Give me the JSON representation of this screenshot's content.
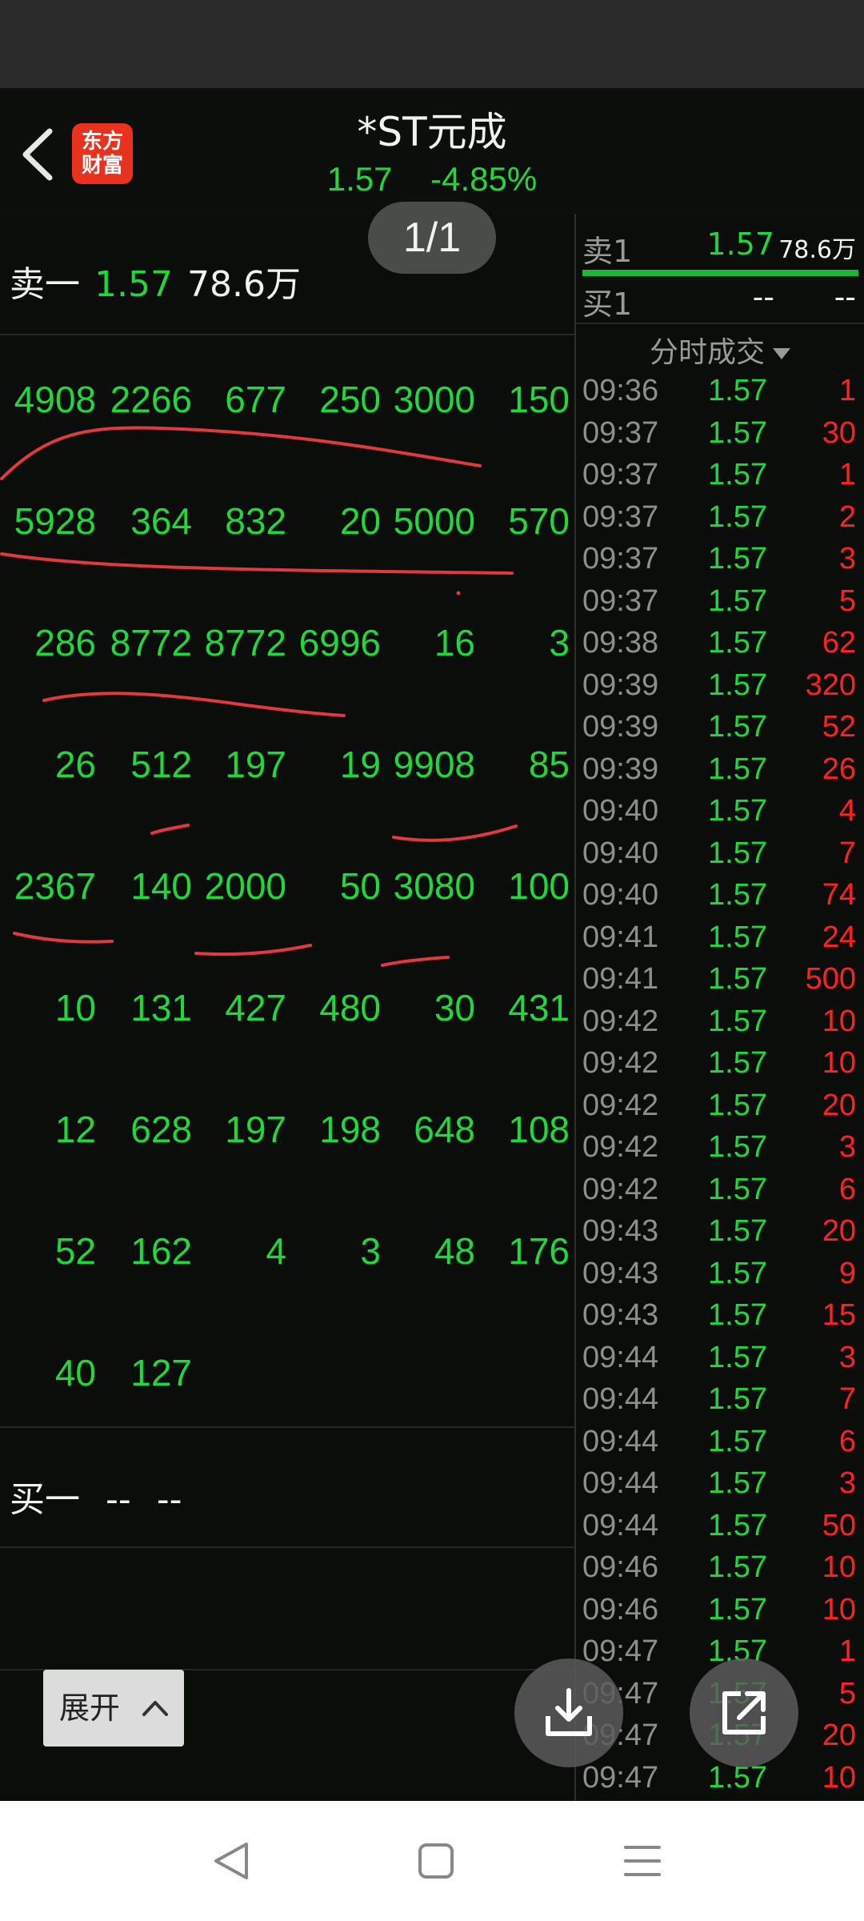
{
  "header": {
    "back_icon": "chevron-left-icon",
    "logo_text_line1": "东方",
    "logo_text_line2": "财富",
    "title": "*ST元成",
    "price": "1.57",
    "change_pct": "-4.85%"
  },
  "pager": {
    "label": "1/1"
  },
  "sell_one": {
    "label": "卖一",
    "price": "1.57",
    "volume": "78.6万"
  },
  "orders": [
    [
      "4908",
      "2266",
      "677",
      "250",
      "3000",
      "150"
    ],
    [
      "5928",
      "364",
      "832",
      "20",
      "5000",
      "570"
    ],
    [
      "286",
      "8772",
      "8772",
      "6996",
      "16",
      "3"
    ],
    [
      "26",
      "512",
      "197",
      "19",
      "9908",
      "85"
    ],
    [
      "2367",
      "140",
      "2000",
      "50",
      "3080",
      "100"
    ],
    [
      "10",
      "131",
      "427",
      "480",
      "30",
      "431"
    ],
    [
      "12",
      "628",
      "197",
      "198",
      "648",
      "108"
    ],
    [
      "52",
      "162",
      "4",
      "3",
      "48",
      "176"
    ],
    [
      "40",
      "127",
      "",
      "",
      "",
      ""
    ]
  ],
  "buy_one": {
    "label": "买一",
    "price": "--",
    "volume": "--"
  },
  "quote": {
    "sell1": {
      "label": "卖1",
      "price": "1.57",
      "volume": "78.6万"
    },
    "buy1": {
      "label": "买1",
      "price": "--",
      "volume": "--"
    }
  },
  "ticks_header": "分时成交",
  "ticks": [
    {
      "t": "09:36",
      "p": "1.57",
      "v": "1"
    },
    {
      "t": "09:37",
      "p": "1.57",
      "v": "30"
    },
    {
      "t": "09:37",
      "p": "1.57",
      "v": "1"
    },
    {
      "t": "09:37",
      "p": "1.57",
      "v": "2"
    },
    {
      "t": "09:37",
      "p": "1.57",
      "v": "3"
    },
    {
      "t": "09:37",
      "p": "1.57",
      "v": "5"
    },
    {
      "t": "09:38",
      "p": "1.57",
      "v": "62"
    },
    {
      "t": "09:39",
      "p": "1.57",
      "v": "320"
    },
    {
      "t": "09:39",
      "p": "1.57",
      "v": "52"
    },
    {
      "t": "09:39",
      "p": "1.57",
      "v": "26"
    },
    {
      "t": "09:40",
      "p": "1.57",
      "v": "4"
    },
    {
      "t": "09:40",
      "p": "1.57",
      "v": "7"
    },
    {
      "t": "09:40",
      "p": "1.57",
      "v": "74"
    },
    {
      "t": "09:41",
      "p": "1.57",
      "v": "24"
    },
    {
      "t": "09:41",
      "p": "1.57",
      "v": "500"
    },
    {
      "t": "09:42",
      "p": "1.57",
      "v": "10"
    },
    {
      "t": "09:42",
      "p": "1.57",
      "v": "10"
    },
    {
      "t": "09:42",
      "p": "1.57",
      "v": "20"
    },
    {
      "t": "09:42",
      "p": "1.57",
      "v": "3"
    },
    {
      "t": "09:42",
      "p": "1.57",
      "v": "6"
    },
    {
      "t": "09:43",
      "p": "1.57",
      "v": "20"
    },
    {
      "t": "09:43",
      "p": "1.57",
      "v": "9"
    },
    {
      "t": "09:43",
      "p": "1.57",
      "v": "15"
    },
    {
      "t": "09:44",
      "p": "1.57",
      "v": "3"
    },
    {
      "t": "09:44",
      "p": "1.57",
      "v": "7"
    },
    {
      "t": "09:44",
      "p": "1.57",
      "v": "6"
    },
    {
      "t": "09:44",
      "p": "1.57",
      "v": "3"
    },
    {
      "t": "09:44",
      "p": "1.57",
      "v": "50"
    },
    {
      "t": "09:46",
      "p": "1.57",
      "v": "10"
    },
    {
      "t": "09:46",
      "p": "1.57",
      "v": "10"
    },
    {
      "t": "09:47",
      "p": "1.57",
      "v": "1"
    },
    {
      "t": "09:47",
      "p": "1.57",
      "v": "5"
    },
    {
      "t": "09:47",
      "p": "1.57",
      "v": "20"
    },
    {
      "t": "09:47",
      "p": "1.57",
      "v": "10"
    }
  ],
  "expand_button": {
    "label": "展开",
    "icon": "chevron-up-icon"
  },
  "fabs": {
    "download_icon": "download-icon",
    "share_icon": "share-icon"
  },
  "nav": {
    "back_icon": "nav-back-icon",
    "home_icon": "nav-home-icon",
    "menu_icon": "nav-menu-icon"
  },
  "colors": {
    "up": "#ff2020",
    "down": "#1fd93a",
    "background": "#0b0d0b",
    "annotation": "#e0393e"
  }
}
